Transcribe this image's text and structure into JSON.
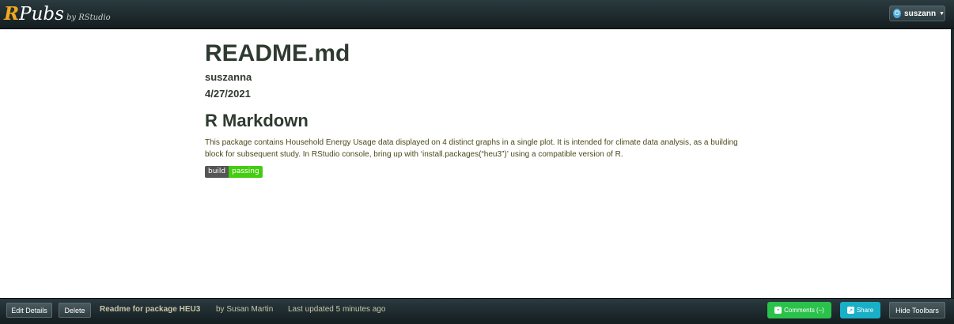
{
  "header": {
    "logo_r": "R",
    "logo_rest": "Pubs",
    "byline": "by RStudio",
    "user_label": "suszann",
    "icons": {
      "user": "power-icon",
      "menu": "caret-down-icon"
    }
  },
  "document": {
    "title": "README.md",
    "author": "suszanna",
    "date": "4/27/2021",
    "section_title": "R Markdown",
    "body": "This package contains Household Energy Usage data displayed on 4 distinct graphs in a single plot. It is intended for climate data analysis, as a building block for subsequent study. In RStudio console, bring up with ‘install.packages(“heu3”)’ using a compatible version of R.",
    "badge": {
      "label": "build",
      "status": "passing",
      "label_color": "#555555",
      "status_color": "#44cc11"
    }
  },
  "footer": {
    "edit_label": "Edit Details",
    "delete_label": "Delete",
    "doc_name": "Readme for package HEU3",
    "doc_author": "by Susan Martin",
    "doc_updated": "Last updated 5 minutes ago",
    "comments_label": "Comments (–)",
    "share_label": "Share",
    "hide_label": "Hide Toolbars",
    "icons": {
      "comments": "comment-icon",
      "share": "share-icon"
    },
    "colors": {
      "comments": "#2bc24b",
      "share": "#19b0c7"
    }
  }
}
